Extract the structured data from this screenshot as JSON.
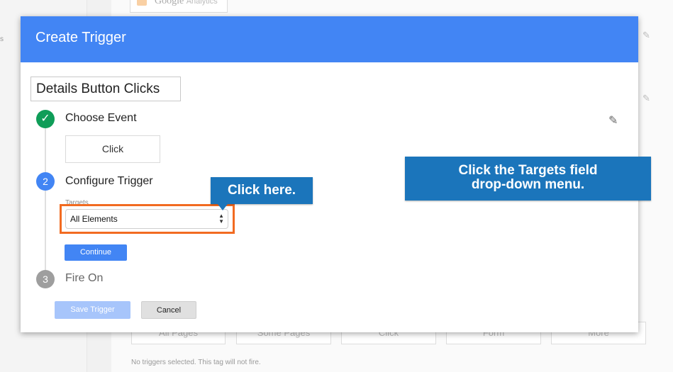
{
  "background": {
    "sidebar_text": "s",
    "ga_logo_text": "Google",
    "ga_logo_sub": "Analytics",
    "chips": [
      "All Pages",
      "Some Pages",
      "Click",
      "Form",
      "More"
    ],
    "empty_message": "No triggers selected. This tag will not fire."
  },
  "dialog": {
    "title": "Create Trigger",
    "trigger_name": "Details Button Clicks",
    "steps": [
      {
        "indicator": "✓",
        "title": "Choose Event",
        "event": "Click"
      },
      {
        "indicator": "2",
        "title": "Configure Trigger",
        "field_label": "Targets",
        "field_value": "All Elements",
        "button": "Continue"
      },
      {
        "indicator": "3",
        "title": "Fire On"
      }
    ],
    "save_button": "Save Trigger",
    "cancel_button": "Cancel"
  },
  "callouts": {
    "small": "Click here.",
    "large_line1": "Click the Targets field",
    "large_line2": "drop-down menu."
  },
  "colors": {
    "header_blue": "#4285f4",
    "done_green": "#0f9d58",
    "callout_blue": "#1b75bb",
    "highlight_orange": "#f26b21"
  }
}
